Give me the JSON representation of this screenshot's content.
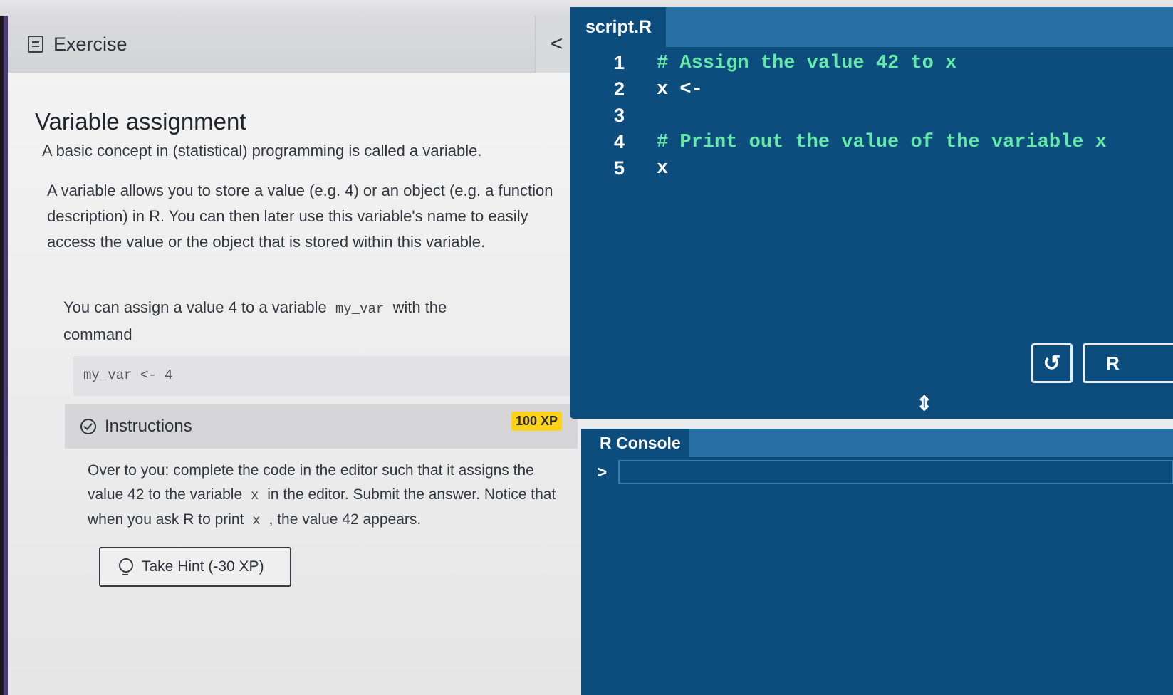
{
  "exercise": {
    "header_label": "Exercise",
    "collapse_glyph": "<",
    "title": "Variable assignment",
    "paragraph_1": "A basic concept in (statistical) programming is called a variable.",
    "paragraph_2": "A variable allows you to store a value (e.g. 4) or an object (e.g. a function description) in R. You can then later use this variable's name to easily access the value or the object that is stored within this variable.",
    "paragraph_3_before": "You can assign a value 4 to a variable",
    "paragraph_3_code": "my_var",
    "paragraph_3_after": "with the command",
    "code_example": "my_var <- 4"
  },
  "instructions": {
    "title": "Instructions",
    "xp_badge": "100 XP",
    "text_1": "Over to you: complete the code in the editor such that it assigns the value 42 to the variable",
    "code_1": "x",
    "text_2": "in the editor. Submit the answer. Notice that when you ask R to print",
    "code_2": "x",
    "text_3": ", the value 42 appears.",
    "hint_label": "Take Hint (-30 XP)"
  },
  "editor": {
    "file_tab": "script.R",
    "lines": [
      {
        "num": "1",
        "text": "# Assign the value 42 to x",
        "kind": "comment"
      },
      {
        "num": "2",
        "text": "x <-",
        "kind": "code"
      },
      {
        "num": "3",
        "text": "",
        "kind": "code"
      },
      {
        "num": "4",
        "text": "# Print out the value of the variable x",
        "kind": "comment"
      },
      {
        "num": "5",
        "text": "x",
        "kind": "code"
      }
    ],
    "reset_glyph": "↺",
    "run_label": "R",
    "resize_glyph": "⇕"
  },
  "console": {
    "tab_label": "R Console",
    "prompt": ">",
    "input_value": ""
  },
  "colors": {
    "editor_bg": "#0d4d7d",
    "tab_bar": "#2770a3",
    "comment": "#65e8a8",
    "xp_badge": "#ffd21a"
  }
}
